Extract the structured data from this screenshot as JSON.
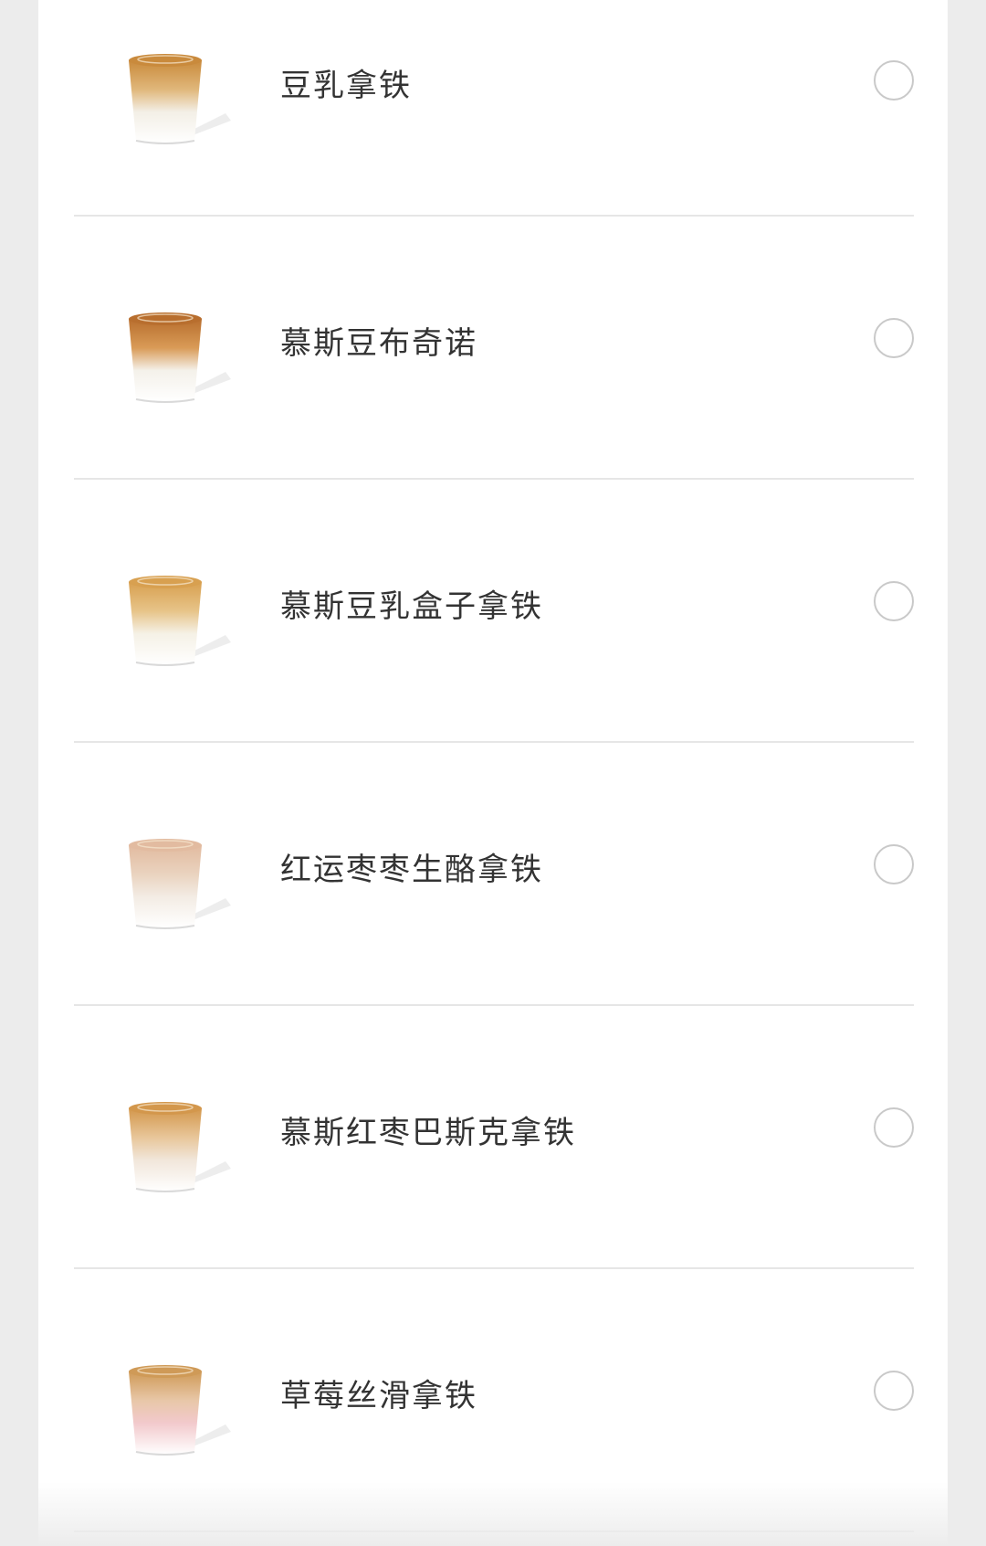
{
  "menu": {
    "items": [
      {
        "name": "豆乳拿铁",
        "icon": "cup-icon",
        "selected": false,
        "colors": {
          "top": "#c98a3c",
          "mid": "#e0b77a",
          "bottom": "#f3efe6"
        }
      },
      {
        "name": "慕斯豆布奇诺",
        "icon": "cup-icon",
        "selected": false,
        "colors": {
          "top": "#b86e2e",
          "mid": "#d99b57",
          "bottom": "#f4f1ea"
        }
      },
      {
        "name": "慕斯豆乳盒子拿铁",
        "icon": "cup-icon",
        "selected": false,
        "colors": {
          "top": "#d8a050",
          "mid": "#e7c489",
          "bottom": "#f5f1e6"
        }
      },
      {
        "name": "红运枣枣生酪拿铁",
        "icon": "cup-icon",
        "selected": false,
        "colors": {
          "top": "#e2bba0",
          "mid": "#ead3bf",
          "bottom": "#f3ece4"
        }
      },
      {
        "name": "慕斯红枣巴斯克拿铁",
        "icon": "cup-icon",
        "selected": false,
        "colors": {
          "top": "#d3974c",
          "mid": "#e8c69a",
          "bottom": "#f1e6da"
        }
      },
      {
        "name": "草莓丝滑拿铁",
        "icon": "cup-icon",
        "selected": false,
        "colors": {
          "top": "#cf9a57",
          "mid": "#e8c7a8",
          "bottom": "#f2c9cc"
        }
      }
    ]
  }
}
